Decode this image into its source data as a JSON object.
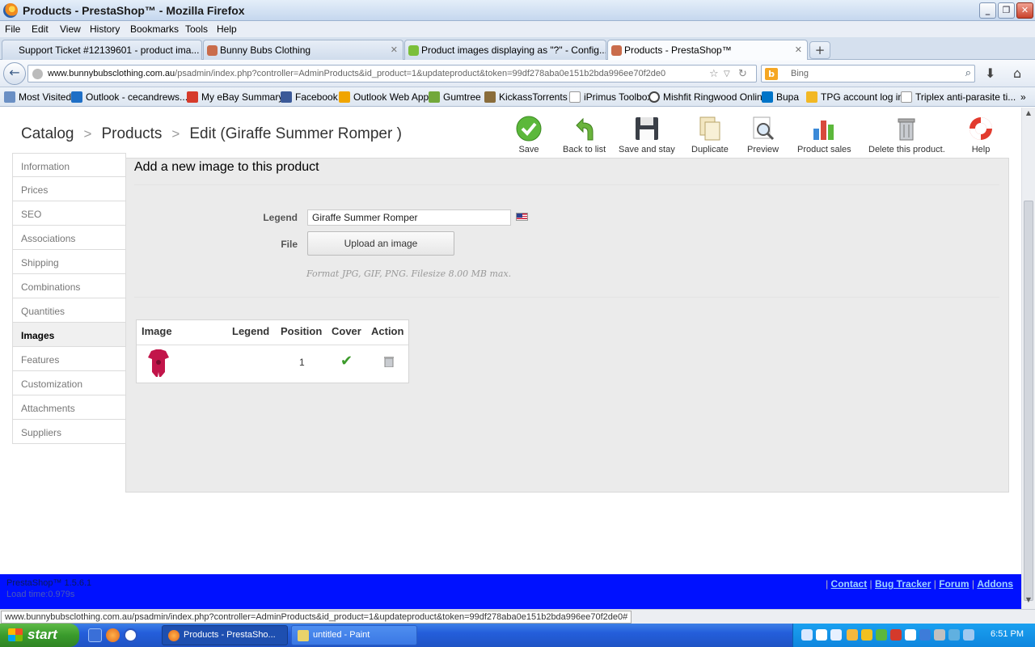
{
  "window": {
    "title": "Products - PrestaShop™ - Mozilla Firefox"
  },
  "menu": [
    "File",
    "Edit",
    "View",
    "History",
    "Bookmarks",
    "Tools",
    "Help"
  ],
  "tabs": [
    {
      "label": "Support Ticket #12139601 - product ima..."
    },
    {
      "label": "Bunny Bubs Clothing"
    },
    {
      "label": "Product images displaying as \"?\" - Config..."
    },
    {
      "label": "Products - PrestaShop™"
    }
  ],
  "address": {
    "domain": "www.bunnybubsclothing.com.au",
    "path": "/psadmin/index.php?controller=AdminProducts&id_product=1&updateproduct&token=99df278aba0e151b2bda996ee70f2de0"
  },
  "search": {
    "placeholder": "Bing",
    "logo": "b"
  },
  "bookmarks": [
    "Most Visited",
    "Outlook - cecandrews...",
    "My eBay Summary",
    "Facebook",
    "Outlook Web App",
    "Gumtree",
    "KickassTorrents",
    "iPrimus Toolbox",
    "Mishfit Ringwood Online",
    "Bupa",
    "TPG account log in",
    "Triplex anti-parasite ti..."
  ],
  "breadcrumb": {
    "catalog": "Catalog",
    "products": "Products",
    "edit": "Edit (Giraffe Summer Romper )",
    "sep": ">"
  },
  "toolbar": {
    "save": "Save",
    "back": "Back to list",
    "save_stay": "Save and stay",
    "duplicate": "Duplicate",
    "preview": "Preview",
    "sales": "Product sales",
    "delete": "Delete this product.",
    "help": "Help"
  },
  "sidebar": {
    "items": [
      "Information",
      "Prices",
      "SEO",
      "Associations",
      "Shipping",
      "Combinations",
      "Quantities",
      "Images",
      "Features",
      "Customization",
      "Attachments",
      "Suppliers"
    ]
  },
  "form": {
    "heading": "Add a new image to this product",
    "legend_label": "Legend",
    "legend_value": "Giraffe Summer Romper",
    "file_label": "File",
    "upload_label": "Upload an image",
    "hint": "Format JPG, GIF, PNG. Filesize 8.00 MB max."
  },
  "images_table": {
    "headers": {
      "image": "Image",
      "legend": "Legend",
      "position": "Position",
      "cover": "Cover",
      "action": "Action"
    },
    "rows": [
      {
        "legend": "",
        "position": "1",
        "cover": true
      }
    ]
  },
  "footer": {
    "version": "PrestaShop™ 1.5.6.1",
    "load_time": "Load time:0.979s",
    "links": {
      "contact": "Contact",
      "bug_tracker": "Bug Tracker",
      "forum": "Forum",
      "addons": "Addons"
    }
  },
  "status": {
    "url": "www.bunnybubsclothing.com.au/psadmin/index.php?controller=AdminProducts&id_product=1&updateproduct&token=99df278aba0e151b2bda996ee70f2de0#"
  },
  "taskbar": {
    "start": "start",
    "items": [
      "Products - PrestaSho...",
      "untitled - Paint"
    ],
    "clock": "6:51 PM"
  },
  "colors": {
    "footer_bg": "#0011ff",
    "taskbar_bg": "#245edb",
    "start_green": "#3a9b2c",
    "check_green": "#3b9a2a"
  }
}
